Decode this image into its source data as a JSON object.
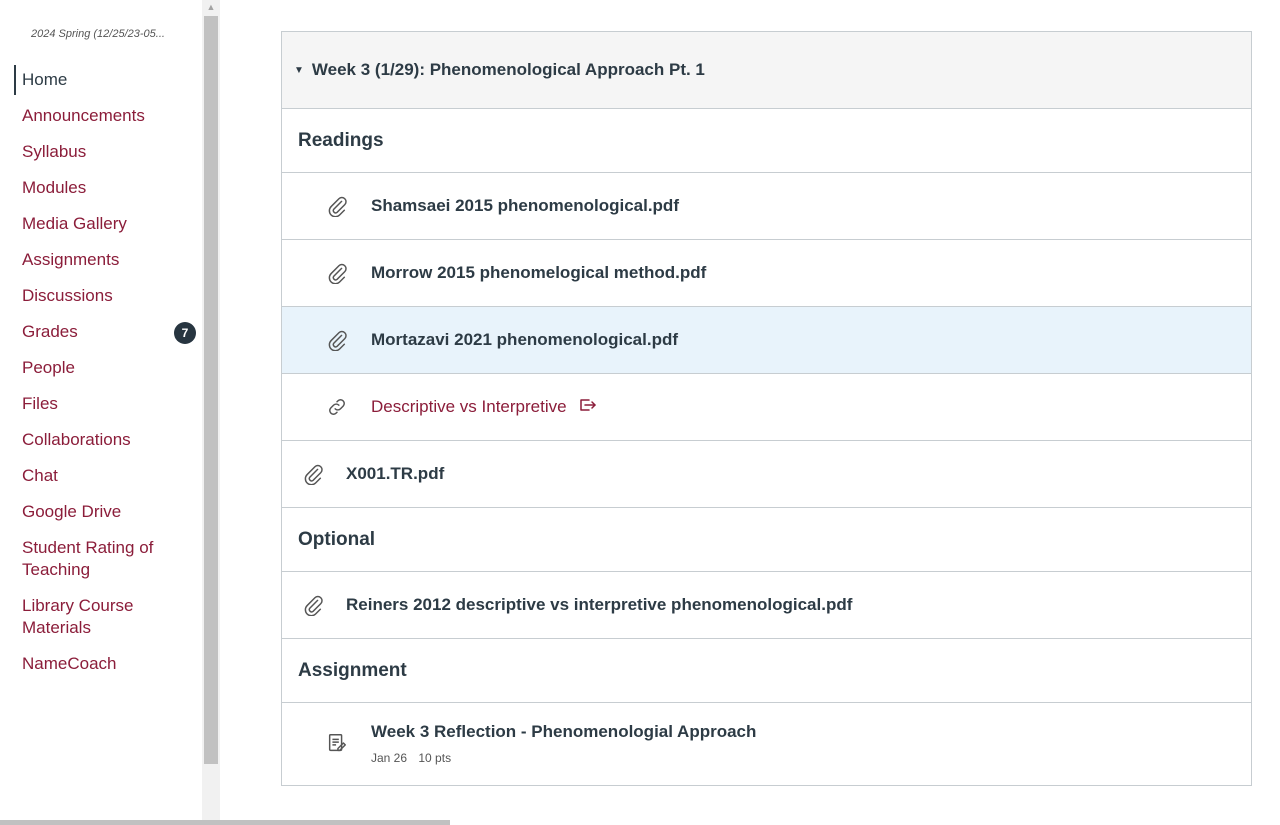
{
  "course": {
    "term": "2024 Spring (12/25/23-05..."
  },
  "nav": {
    "items": [
      {
        "label": "Home",
        "active": true
      },
      {
        "label": "Announcements"
      },
      {
        "label": "Syllabus"
      },
      {
        "label": "Modules"
      },
      {
        "label": "Media Gallery"
      },
      {
        "label": "Assignments"
      },
      {
        "label": "Discussions"
      },
      {
        "label": "Grades",
        "badge": "7"
      },
      {
        "label": "People"
      },
      {
        "label": "Files"
      },
      {
        "label": "Collaborations"
      },
      {
        "label": "Chat"
      },
      {
        "label": "Google Drive"
      },
      {
        "label": "Student Rating of Teaching"
      },
      {
        "label": "Library Course Materials"
      },
      {
        "label": "NameCoach"
      }
    ]
  },
  "module": {
    "title": "Week 3 (1/29): Phenomenological Approach Pt. 1",
    "sections": {
      "readings": "Readings",
      "optional": "Optional",
      "assignment": "Assignment"
    },
    "items": {
      "shamsaei": "Shamsaei 2015 phenomenological.pdf",
      "morrow": "Morrow 2015 phenomelogical method.pdf",
      "mortazavi": "Mortazavi 2021 phenomenological.pdf",
      "descriptive": "Descriptive vs Interpretive",
      "x001": "X001.TR.pdf",
      "reiners": "Reiners 2012 descriptive vs interpretive phenomenological.pdf"
    },
    "assignment": {
      "title": "Week 3 Reflection - Phenomenologial Approach",
      "due": "Jan 26",
      "points": "10 pts"
    }
  },
  "colors": {
    "link": "#8b1d3a",
    "text": "#2d3b45",
    "highlight": "#e8f3fb",
    "badge": "#273540"
  }
}
